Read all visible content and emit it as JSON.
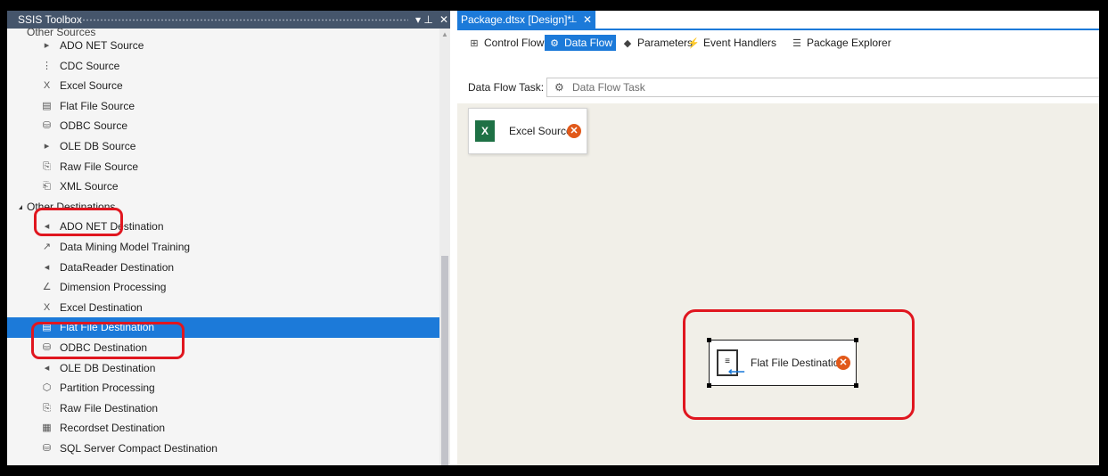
{
  "toolbox": {
    "title": "SSIS Toolbox",
    "pin_glyph": "▾ ⊥",
    "close_glyph": "✕",
    "cut_off_label": "Other Sources",
    "items": [
      {
        "label": "ADO NET Source",
        "icon": "ado-net-source-icon",
        "glyph": "▸",
        "type": "item"
      },
      {
        "label": "CDC Source",
        "icon": "cdc-source-icon",
        "glyph": "⋮",
        "type": "item"
      },
      {
        "label": "Excel Source",
        "icon": "excel-source-icon",
        "glyph": "X",
        "type": "item"
      },
      {
        "label": "Flat File Source",
        "icon": "flat-file-source-icon",
        "glyph": "▤",
        "type": "item"
      },
      {
        "label": "ODBC Source",
        "icon": "odbc-source-icon",
        "glyph": "⛁",
        "type": "item"
      },
      {
        "label": "OLE DB Source",
        "icon": "ole-db-source-icon",
        "glyph": "▸",
        "type": "item"
      },
      {
        "label": "Raw File Source",
        "icon": "raw-file-source-icon",
        "glyph": "⎘",
        "type": "item"
      },
      {
        "label": "XML Source",
        "icon": "xml-source-icon",
        "glyph": "⎗",
        "type": "item"
      },
      {
        "label": "Other Destinations",
        "icon": "",
        "glyph": "",
        "type": "category"
      },
      {
        "label": "ADO NET Destination",
        "icon": "ado-net-destination-icon",
        "glyph": "◂",
        "type": "item"
      },
      {
        "label": "Data Mining Model Training",
        "icon": "data-mining-icon",
        "glyph": "↗",
        "type": "item"
      },
      {
        "label": "DataReader Destination",
        "icon": "datareader-destination-icon",
        "glyph": "◂",
        "type": "item"
      },
      {
        "label": "Dimension Processing",
        "icon": "dimension-processing-icon",
        "glyph": "∠",
        "type": "item"
      },
      {
        "label": "Excel Destination",
        "icon": "excel-destination-icon",
        "glyph": "X",
        "type": "item"
      },
      {
        "label": "Flat File Destination",
        "icon": "flat-file-destination-icon",
        "glyph": "▤",
        "type": "selected"
      },
      {
        "label": "ODBC Destination",
        "icon": "odbc-destination-icon",
        "glyph": "⛁",
        "type": "item"
      },
      {
        "label": "OLE DB Destination",
        "icon": "ole-db-destination-icon",
        "glyph": "◂",
        "type": "item"
      },
      {
        "label": "Partition Processing",
        "icon": "partition-processing-icon",
        "glyph": "⬡",
        "type": "item"
      },
      {
        "label": "Raw File Destination",
        "icon": "raw-file-destination-icon",
        "glyph": "⎘",
        "type": "item"
      },
      {
        "label": "Recordset Destination",
        "icon": "recordset-destination-icon",
        "glyph": "▦",
        "type": "item"
      },
      {
        "label": "SQL Server Compact Destination",
        "icon": "sql-compact-destination-icon",
        "glyph": "⛁",
        "type": "item"
      }
    ]
  },
  "document_tab": {
    "title": "Package.dtsx [Design]*",
    "pin_glyph": "⊥",
    "close_glyph": "✕"
  },
  "design_tabs": [
    {
      "label": "Control Flow",
      "icon": "control-flow-icon",
      "glyph": "⊞",
      "active": false
    },
    {
      "label": "Data Flow",
      "icon": "data-flow-icon",
      "glyph": "⚙",
      "active": true
    },
    {
      "label": "Parameters",
      "icon": "parameters-icon",
      "glyph": "◆",
      "active": false
    },
    {
      "label": "Event Handlers",
      "icon": "event-handlers-icon",
      "glyph": "⚡",
      "active": false
    },
    {
      "label": "Package Explorer",
      "icon": "package-explorer-icon",
      "glyph": "☰",
      "active": false
    }
  ],
  "task_bar": {
    "label": "Data Flow Task:",
    "value": "Data Flow Task",
    "icon": "data-flow-task-icon"
  },
  "canvas": {
    "components": [
      {
        "name": "Excel Source",
        "icon": "excel-source-icon",
        "error_glyph": "✕"
      },
      {
        "name": "Flat File Destination",
        "icon": "flat-file-destination-icon",
        "error_glyph": "✕"
      }
    ]
  },
  "colors": {
    "accent": "#1c7ad9",
    "highlight": "#e0161f",
    "error": "#e1591a",
    "canvas": "#f1efe8",
    "title_bar": "#45556b"
  }
}
